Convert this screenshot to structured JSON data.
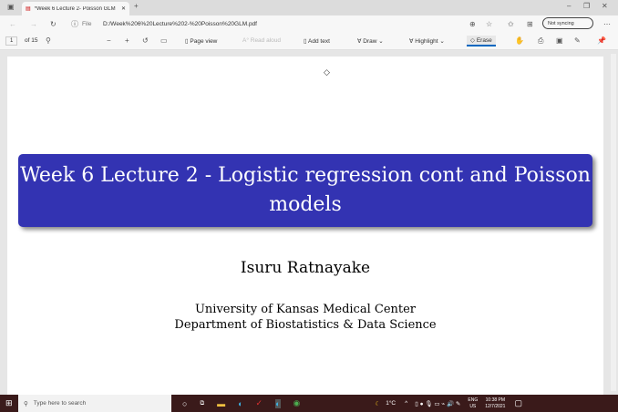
{
  "browser": {
    "tab_title": "*Week 6 Lecture 2- Poisson GLM",
    "url_label": "File",
    "url": "D:/Week%206%20Lecture%202-%20Poisson%20GLM.pdf",
    "sync": "Not syncing"
  },
  "pdf_toolbar": {
    "page": "1",
    "of": "of 15",
    "page_view": "Page view",
    "read_aloud": "Read aloud",
    "add_text": "Add text",
    "draw": "Draw",
    "highlight": "Highlight",
    "erase": "Erase"
  },
  "slide": {
    "title": "Week 6 Lecture 2 - Logistic regression cont and Poisson models",
    "author": "Isuru Ratnayake",
    "affiliation1": "University of Kansas Medical Center",
    "affiliation2": "Department of Biostatistics & Data Science"
  },
  "taskbar": {
    "search": "Type here to search",
    "temp": "1°C",
    "lang": "ENG",
    "region": "US",
    "time": "10:38 PM",
    "date": "12/7/2021"
  }
}
